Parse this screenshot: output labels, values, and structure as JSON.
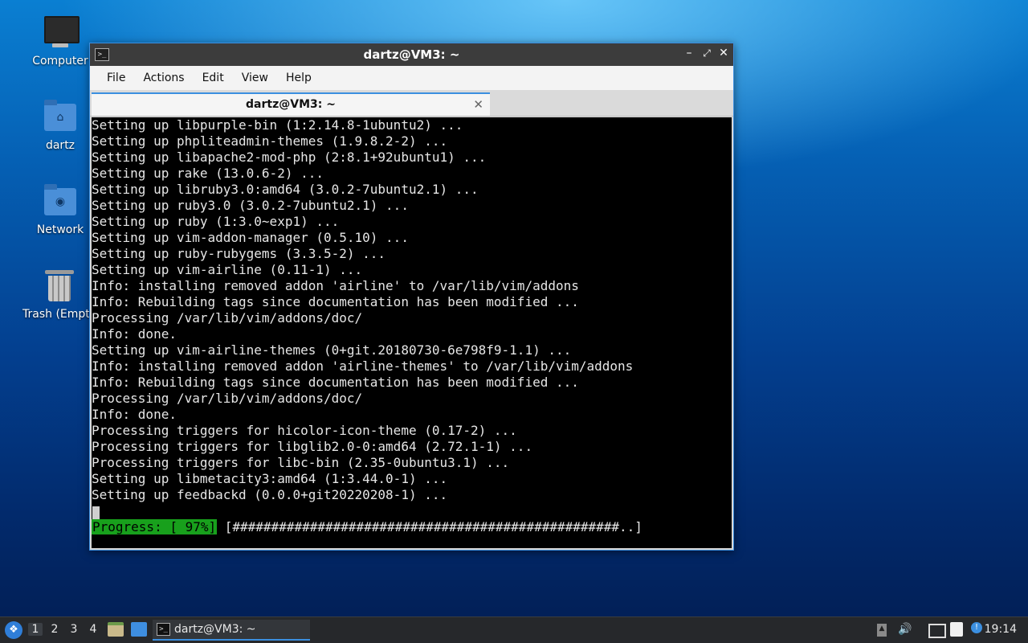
{
  "desktop": {
    "icons": [
      {
        "label": "Computer"
      },
      {
        "label": "dartz"
      },
      {
        "label": "Network"
      },
      {
        "label": "Trash (Empt"
      }
    ]
  },
  "window": {
    "title": "dartz@VM3: ~",
    "menu": [
      "File",
      "Actions",
      "Edit",
      "View",
      "Help"
    ],
    "tab_label": "dartz@VM3: ~",
    "terminal_lines": [
      "Setting up libpurple-bin (1:2.14.8-1ubuntu2) ...",
      "Setting up phpliteadmin-themes (1.9.8.2-2) ...",
      "Setting up libapache2-mod-php (2:8.1+92ubuntu1) ...",
      "Setting up rake (13.0.6-2) ...",
      "Setting up libruby3.0:amd64 (3.0.2-7ubuntu2.1) ...",
      "Setting up ruby3.0 (3.0.2-7ubuntu2.1) ...",
      "Setting up ruby (1:3.0~exp1) ...",
      "Setting up vim-addon-manager (0.5.10) ...",
      "Setting up ruby-rubygems (3.3.5-2) ...",
      "Setting up vim-airline (0.11-1) ...",
      "Info: installing removed addon 'airline' to /var/lib/vim/addons",
      "Info: Rebuilding tags since documentation has been modified ...",
      "Processing /var/lib/vim/addons/doc/",
      "Info: done.",
      "Setting up vim-airline-themes (0+git.20180730-6e798f9-1.1) ...",
      "Info: installing removed addon 'airline-themes' to /var/lib/vim/addons",
      "Info: Rebuilding tags since documentation has been modified ...",
      "Processing /var/lib/vim/addons/doc/",
      "Info: done.",
      "Processing triggers for hicolor-icon-theme (0.17-2) ...",
      "Processing triggers for libglib2.0-0:amd64 (2.72.1-1) ...",
      "Processing triggers for libc-bin (2.35-0ubuntu3.1) ...",
      "Setting up libmetacity3:amd64 (1:3.44.0-1) ...",
      "Setting up feedbackd (0.0.0+git20220208-1) ..."
    ],
    "progress_label": "Progress: [ 97%]",
    "progress_bar": " [##################################################..]",
    "progress_percent": 97
  },
  "taskbar": {
    "workspaces": [
      "1",
      "2",
      "3",
      "4"
    ],
    "active_workspace": "1",
    "task_label": "dartz@VM3: ~",
    "clock": "19:14"
  },
  "colors": {
    "accent": "#3b8fe0",
    "progress_green": "#18a01c",
    "terminal_bg": "#000000",
    "terminal_fg": "#e6e6e6"
  }
}
